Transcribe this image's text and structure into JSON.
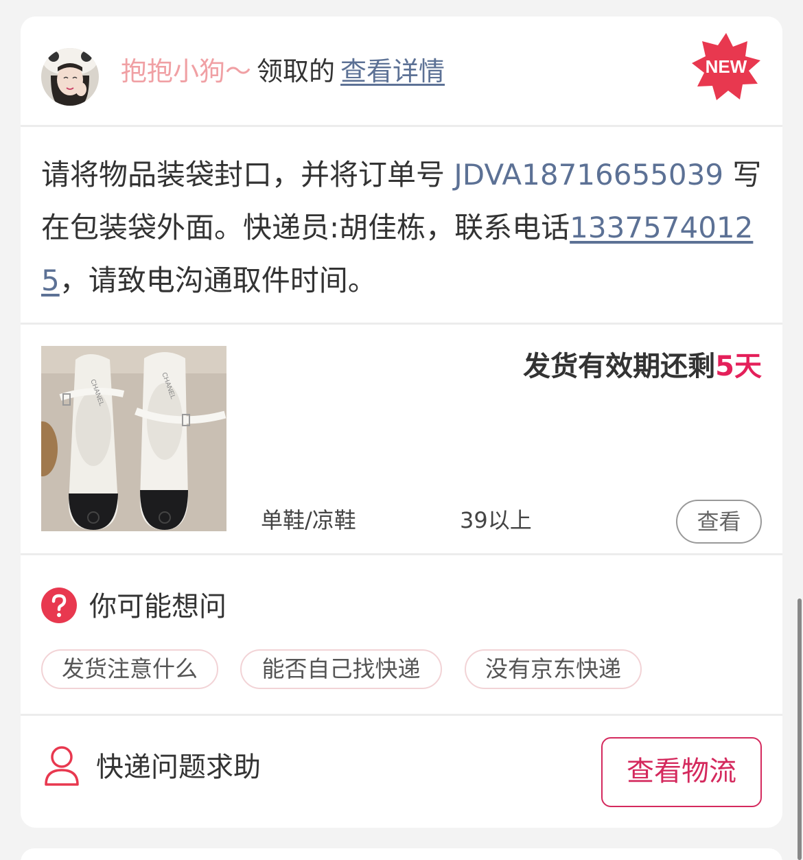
{
  "header": {
    "username": "抱抱小狗～",
    "claim_text": "领取的",
    "details_link": "查看详情",
    "badge": "NEW"
  },
  "notice": {
    "part1": "请将物品装袋封口，并将订单号 ",
    "order_no": "JDVA18716655039",
    "part2": " 写在包装袋外面。快递员:胡佳栋，联系电话",
    "phone": "13375740125",
    "part3": "，请致电沟通取件时间。"
  },
  "item": {
    "image_brand": "CHANEL",
    "expiry_prefix": "发货有效期还剩",
    "expiry_days": "5天",
    "category": "单鞋/凉鞋",
    "size": "39以上",
    "view_button": "查看"
  },
  "faq": {
    "title": "你可能想问",
    "chips": [
      "发货注意什么",
      "能否自己找快递",
      "没有京东快递"
    ]
  },
  "footer": {
    "help_text": "快递问题求助",
    "logistics_button": "查看物流"
  },
  "colors": {
    "username": "#f0a0a4",
    "link": "#5c7195",
    "accent": "#e4205a",
    "badge": "#e8384f",
    "button_border": "#d4295d"
  }
}
